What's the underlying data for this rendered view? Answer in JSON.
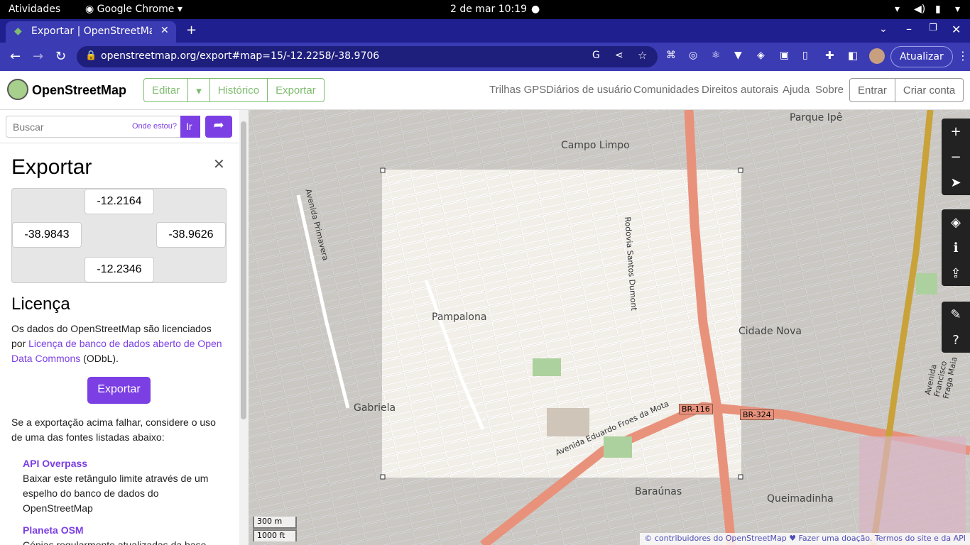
{
  "system_bar": {
    "activities": "Atividades",
    "app": "Google Chrome",
    "datetime": "2 de mar  10:19"
  },
  "browser": {
    "tab_title": "Exportar | OpenStreetMap",
    "url": "openstreetmap.org/export#map=15/-12.2258/-38.9706",
    "update_label": "Atualizar"
  },
  "osm_header": {
    "logo": "OpenStreetMap",
    "edit": "Editar",
    "history": "Histórico",
    "export": "Exportar",
    "nav": [
      "Trilhas GPS",
      "Diários de usuário",
      "Comunidades",
      "Direitos autorais",
      "Ajuda",
      "Sobre"
    ],
    "login": "Entrar",
    "signup": "Criar conta"
  },
  "search": {
    "placeholder": "Buscar",
    "where": "Onde estou?",
    "go": "Ir"
  },
  "export_panel": {
    "title": "Exportar",
    "north": "-12.2164",
    "west": "-38.9843",
    "east": "-38.9626",
    "south": "-12.2346",
    "license_title": "Licença",
    "license_text_1": "Os dados do OpenStreetMap são licenciados por ",
    "license_link": "Licença de banco de dados aberto de Open Data Commons",
    "license_text_2": " (ODbL).",
    "export_button": "Exportar",
    "fallback_text": "Se a exportação acima falhar, considere o uso de uma das fontes listadas abaixo:",
    "sources": [
      {
        "name": "API Overpass",
        "desc": "Baixar este retângulo limite através de um espelho do banco de dados do OpenStreetMap"
      },
      {
        "name": "Planeta OSM",
        "desc": "Cópias regularmente atualizadas da base"
      }
    ]
  },
  "map": {
    "scale_m": "300 m",
    "scale_ft": "1000 ft",
    "attribution": "© contribuidores do OpenStreetMap ♥ Fazer uma doação. Termos do site e da API",
    "labels": [
      "Campo Limpo",
      "Parque Ipê",
      "Pampalona",
      "Cidade Nova",
      "Gabriela",
      "Baraúnas",
      "Queimadinha"
    ],
    "roads": [
      "Rodovia Santos Dumont",
      "Avenida Eduardo Froes da Mota",
      "BR-116",
      "BR-324",
      "Avenida Francisco Fraga Maia",
      "Avenida Primavera"
    ]
  }
}
